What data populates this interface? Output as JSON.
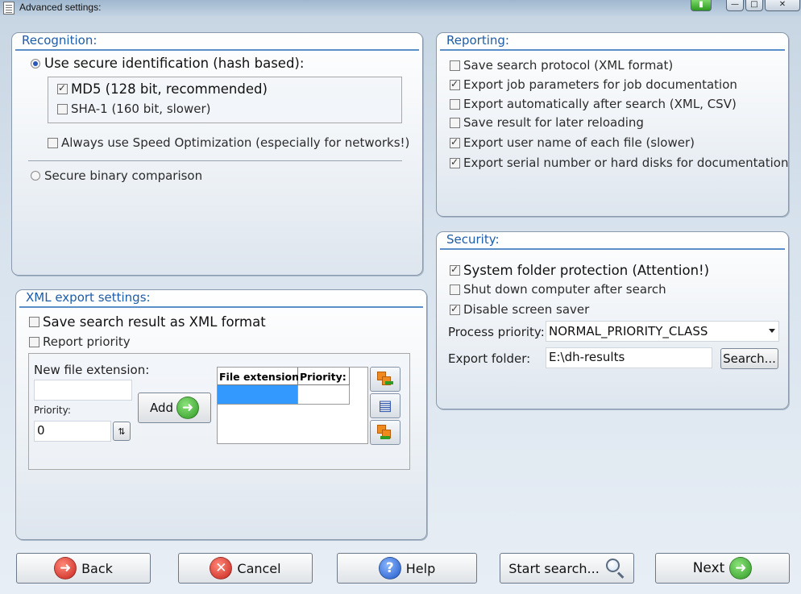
{
  "window": {
    "title": "Advanced settings:"
  },
  "recognition": {
    "title": "Recognition:",
    "hash_option": "Use secure identification (hash based):",
    "md5": "MD5 (128 bit, recommended)",
    "sha1": "SHA-1 (160 bit, slower)",
    "speed_opt": "Always use Speed Optimization (especially for networks!)",
    "binary": "Secure binary comparison"
  },
  "xml_export": {
    "title": "XML export settings:",
    "save_xml": "Save search result as XML format",
    "report_priority": "Report priority",
    "new_ext_label": "New file extension:",
    "new_ext_value": "",
    "priority_label": "Priority:",
    "priority_value": "0",
    "add_label": "Add",
    "grid_columns": [
      "File extension:",
      "Priority:"
    ]
  },
  "reporting": {
    "title": "Reporting:",
    "items": [
      {
        "label": "Save search protocol (XML format)",
        "checked": false
      },
      {
        "label": "Export job parameters for job documentation",
        "checked": true
      },
      {
        "label": "Export automatically after search (XML, CSV)",
        "checked": false
      },
      {
        "label": "Save result for later reloading",
        "checked": false
      },
      {
        "label": "Export user name of each file (slower)",
        "checked": true
      },
      {
        "label": "Export serial number or hard disks for documentation",
        "checked": true
      }
    ]
  },
  "security": {
    "title": "Security:",
    "system_folder": "System folder protection (Attention!)",
    "shutdown": "Shut down computer after search",
    "screensaver": "Disable screen saver",
    "process_priority_label": "Process priority:",
    "process_priority_value": "NORMAL_PRIORITY_CLASS",
    "export_folder_label": "Export folder:",
    "export_folder_value": "E:\\dh-results",
    "search_button": "Search..."
  },
  "footer": {
    "back": "Back",
    "cancel": "Cancel",
    "help": "Help",
    "start_search": "Start search...",
    "next": "Next"
  },
  "colors": {
    "group_title": "#1d5da8",
    "green_icon": "#2f9b24",
    "red_icon": "#c8231c",
    "blue_icon": "#1e57c8",
    "selection": "#3399ff"
  }
}
